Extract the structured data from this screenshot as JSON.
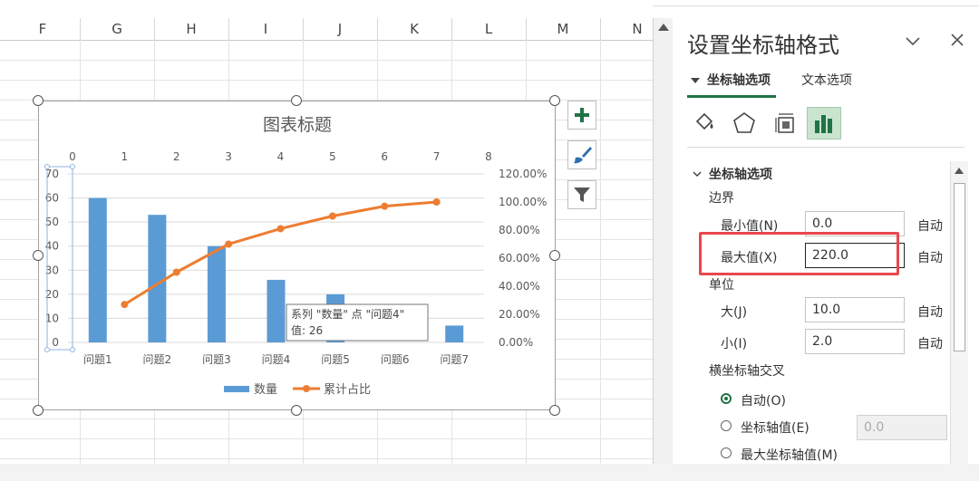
{
  "sheet": {
    "columns": [
      "F",
      "G",
      "H",
      "I",
      "J",
      "K",
      "L",
      "M",
      "N"
    ]
  },
  "chart_data": {
    "type": "bar",
    "title": "图表标题",
    "categories": [
      "问题1",
      "问题2",
      "问题3",
      "问题4",
      "问题5",
      "问题6",
      "问题7"
    ],
    "series": [
      {
        "name": "数量",
        "type": "bar",
        "axis": "primary",
        "values": [
          60,
          53,
          40,
          26,
          20,
          0,
          7
        ],
        "color": "#5b9bd5"
      },
      {
        "name": "累计占比",
        "type": "line",
        "axis": "secondary",
        "x": [
          1,
          2,
          3,
          4,
          5,
          6,
          7
        ],
        "values": [
          0.27,
          0.5,
          0.7,
          0.81,
          0.9,
          0.97,
          1.0
        ],
        "color": "#ed7d31"
      }
    ],
    "y_axis": {
      "min": 0,
      "max": 70,
      "ticks": [
        "0",
        "10",
        "20",
        "30",
        "40",
        "50",
        "60",
        "70"
      ]
    },
    "secondary_y_axis": {
      "min": 0,
      "max": 1.2,
      "ticks": [
        "0.00%",
        "20.00%",
        "40.00%",
        "60.00%",
        "80.00%",
        "100.00%",
        "120.00%"
      ]
    },
    "secondary_x_axis": {
      "min": 0,
      "max": 8,
      "ticks": [
        "0",
        "1",
        "2",
        "3",
        "4",
        "5",
        "6",
        "7",
        "8"
      ]
    },
    "legend": "bottom",
    "grid": true,
    "tooltip": {
      "line1": "系列 \"数量\" 点 \"问题4\"",
      "line2": "值: 26"
    }
  },
  "pane": {
    "title": "设置坐标轴格式",
    "tabs": [
      "坐标轴选项",
      "文本选项"
    ],
    "section": "坐标轴选项",
    "bounds_label": "边界",
    "min_label": "最小值(N)",
    "min_value": "0.0",
    "max_label": "最大值(X)",
    "max_value": "220.0",
    "units_label": "单位",
    "major_label": "大(J)",
    "major_value": "10.0",
    "minor_label": "小(I)",
    "minor_value": "2.0",
    "auto": "自动",
    "cross_label": "横坐标轴交叉",
    "radio_auto": "自动(O)",
    "radio_value": "坐标轴值(E)",
    "radio_value_input": "0.0",
    "radio_max": "最大坐标轴值(M)"
  },
  "colors": {
    "accent": "#217346",
    "highlight": "#e8474c"
  }
}
